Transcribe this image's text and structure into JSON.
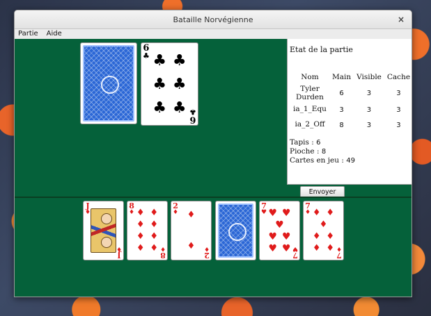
{
  "window": {
    "title": "Bataille Norvégienne",
    "close_glyph": "×"
  },
  "menu": [
    "Partie",
    "Aide"
  ],
  "table_cards": [
    {
      "face": "back"
    },
    {
      "rank": "6",
      "suit": "♣",
      "color": "black",
      "pips": 6
    }
  ],
  "status": {
    "title": "Etat de la partie",
    "columns": [
      "Nom",
      "Main",
      "Visible",
      "Cache"
    ],
    "players": [
      {
        "name": "Tyler Durden",
        "main": "6",
        "visible": "3",
        "cache": "3"
      },
      {
        "name": "ia_1_Equ",
        "main": "3",
        "visible": "3",
        "cache": "3"
      },
      {
        "name": "ia_2_Off",
        "main": "8",
        "visible": "3",
        "cache": "3"
      }
    ],
    "tapis_label": "Tapis :",
    "tapis": "6",
    "pioche_label": "Pioche :",
    "pioche": "8",
    "cartes_label": "Cartes en jeu :",
    "cartes": "49"
  },
  "send_button": "Envoyer",
  "hand_cards": [
    {
      "rank": "J",
      "suit": "♦",
      "color": "red",
      "face": "jack"
    },
    {
      "rank": "8",
      "suit": "♦",
      "color": "red",
      "pips": 8
    },
    {
      "rank": "2",
      "suit": "♦",
      "color": "red",
      "pips": 2
    },
    {
      "face": "back"
    },
    {
      "rank": "7",
      "suit": "♥",
      "color": "red",
      "pips": 7
    },
    {
      "rank": "7",
      "suit": "♦",
      "color": "red",
      "pips": 7
    }
  ],
  "colors": {
    "felt": "#05613a",
    "card_back": "#2b67d6",
    "red_suit": "#e01b1b"
  }
}
